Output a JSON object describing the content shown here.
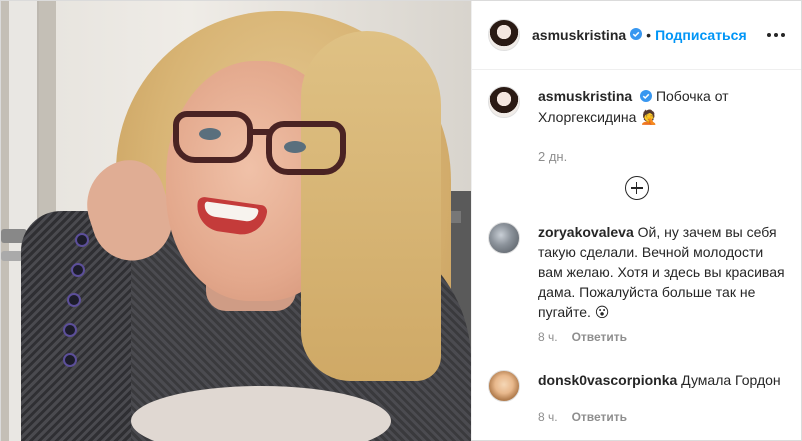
{
  "post": {
    "author": "asmuskristina",
    "follow_label": "Подписаться",
    "separator": "•",
    "caption_text": "Побочка от Хлоргексидина 🤦",
    "caption_time": "2 дн."
  },
  "comments": [
    {
      "user": "zoryakovaleva",
      "text": "Ой, ну зачем вы себя такую сделали. Вечной молодости вам желаю. Хотя и здесь вы красивая дама. Пожалуйста больше так не пугайте. 😮",
      "time": "8 ч.",
      "reply_label": "Ответить"
    },
    {
      "user": "donsk0vascorpionka",
      "text": "Думала Гордон",
      "time": "8 ч.",
      "reply_label": "Ответить"
    }
  ],
  "icons": {
    "verified": "verified-badge-icon",
    "more": "more-options-icon",
    "load_more": "plus-circle-icon"
  },
  "colors": {
    "link": "#0095f6",
    "verified": "#3897f0",
    "meta": "#8e8e8e",
    "text": "#262626"
  }
}
